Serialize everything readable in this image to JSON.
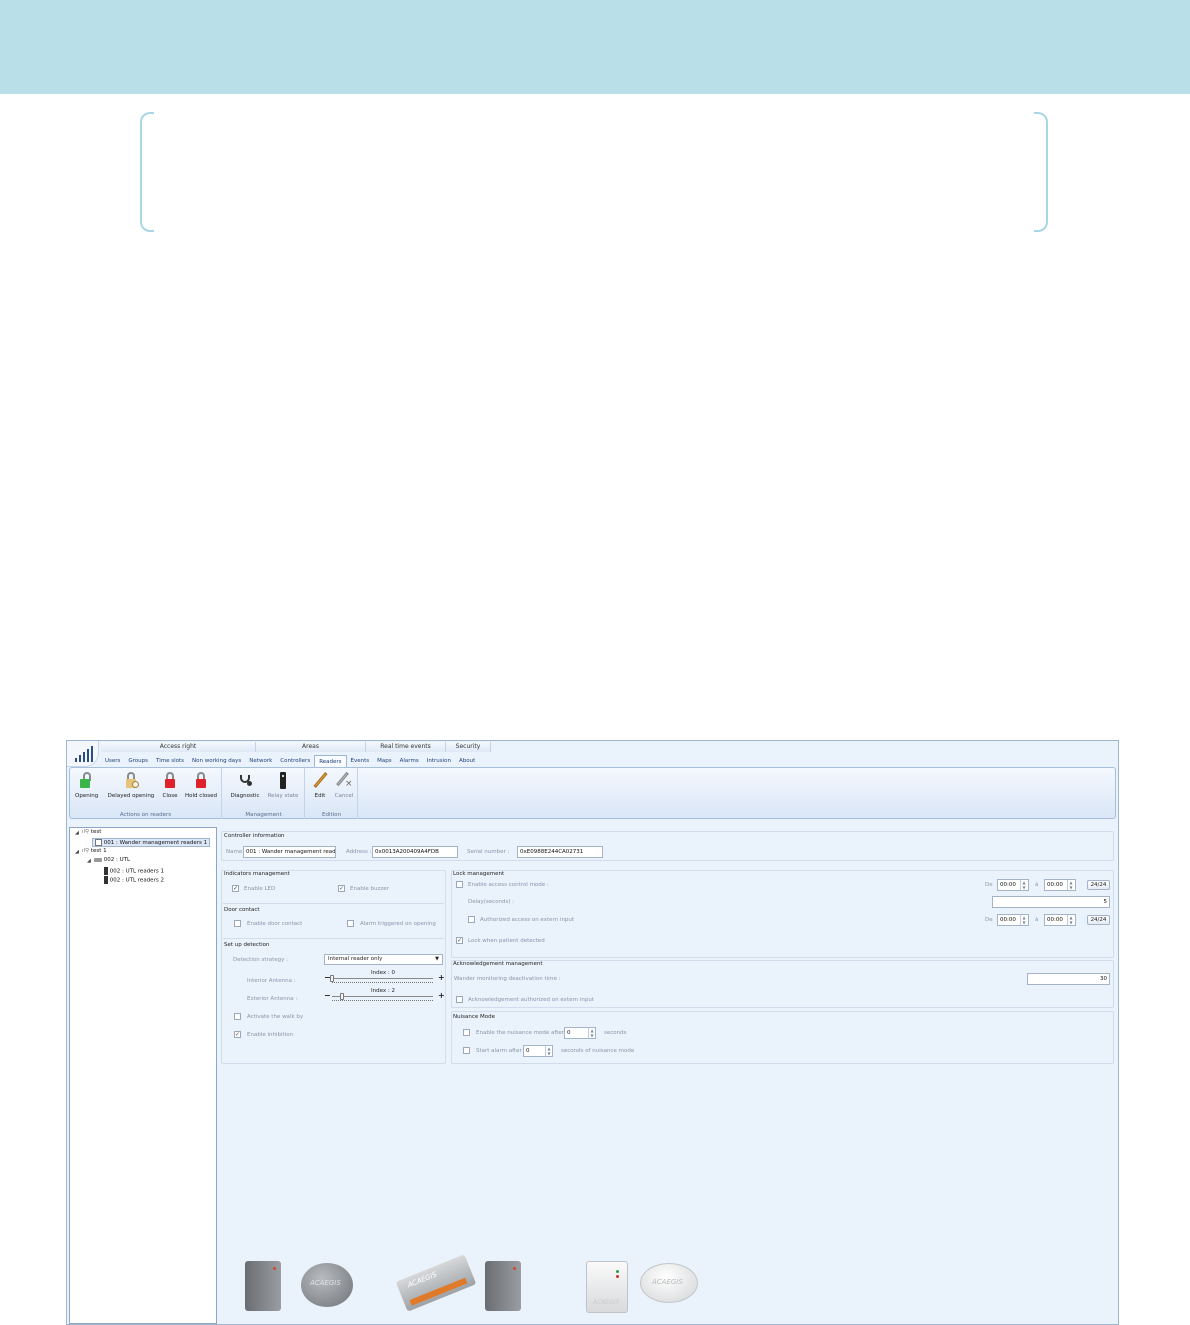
{
  "ribbon_tabs": {
    "modules": [
      "Access right",
      "Areas",
      "Real time events",
      "Security"
    ],
    "tabs": [
      "Users",
      "Groups",
      "Time slots",
      "Non working days",
      "Network",
      "Controllers",
      "Readers",
      "Events",
      "Maps",
      "Alarms",
      "Intrusion",
      "About"
    ],
    "active_tab": "Readers"
  },
  "ribbon": {
    "actions": {
      "opening": "Opening",
      "delayed_opening": "Delayed opening",
      "close": "Close",
      "hold_closed": "Hold closed",
      "group_label": "Actions on readers"
    },
    "management": {
      "diagnostic": "Diagnostic",
      "relay_state": "Relay state",
      "group_label": "Management"
    },
    "edition": {
      "edit": "Edit",
      "cancel": "Cancel",
      "group_label": "Edition"
    }
  },
  "tree": {
    "n1": "test",
    "n1_child": "001 : Wander management readers 1",
    "n2": "test 1",
    "n2_child": "002 : UTL",
    "n2_r1": "002 : UTL readers 1",
    "n2_r2": "002 : UTL readers 2"
  },
  "controller_info": {
    "title": "Controller information",
    "name_label": "Name :",
    "name_value": "001 : Wander management reader",
    "address_label": "Address :",
    "address_value": "0x0013A200409A4FDB",
    "serial_label": "Serial number :",
    "serial_value": "0xE0988E244CA02731"
  },
  "indicators": {
    "title": "Indicators management",
    "enable_led": "Enable LED",
    "enable_buzzer": "Enable buzzer"
  },
  "door_contact": {
    "title": "Door contact",
    "enable_door_contact": "Enable door contact",
    "alarm_triggered": "Alarm triggered on opening"
  },
  "setup_detection": {
    "title": "Set up detection",
    "strategy_label": "Detection strategy :",
    "strategy_value": "Internal reader only",
    "interior_label": "Interior Antenna :",
    "interior_index": "Index : 0",
    "interior_level": 0,
    "exterior_label": "Exterior Antenna :",
    "exterior_index": "Index : 2",
    "exterior_level": 2,
    "walk_by": "Activate the walk by",
    "inhibition": "Enable inhibition"
  },
  "lock_management": {
    "title": "Lock management",
    "enable_access_control": "Enable access control mode :",
    "delay_label": "Delay(seconds) :",
    "delay_value": "5",
    "authorized_extern": "Authorized access on extern input",
    "lock_patient": "Lock when patient detected",
    "de_label": "De",
    "a_label": "à",
    "time_from": "00:00",
    "time_to": "00:00",
    "btn_24": "24/24"
  },
  "ack_management": {
    "title": "Acknowledgement management",
    "wander_label": "Wander monitoring deactivation time :",
    "wander_value": "30",
    "ack_extern": "Acknowledgement authorized on extern input"
  },
  "nuisance": {
    "title": "Nuisance Mode",
    "enable_label": "Enable the nuisance mode after",
    "enable_value": "0",
    "seconds": "seconds",
    "start_alarm_label": "Start alarm after",
    "start_alarm_value": "0",
    "seconds_nuisance": "seconds of nuisance mode"
  },
  "devices": {
    "logo_text": "ACAEGIS"
  },
  "colors": {
    "top_band": "#b9dfe8",
    "app_bg": "#eaf2fc",
    "lock_green": "#39b54a",
    "lock_red": "#e0202a"
  }
}
